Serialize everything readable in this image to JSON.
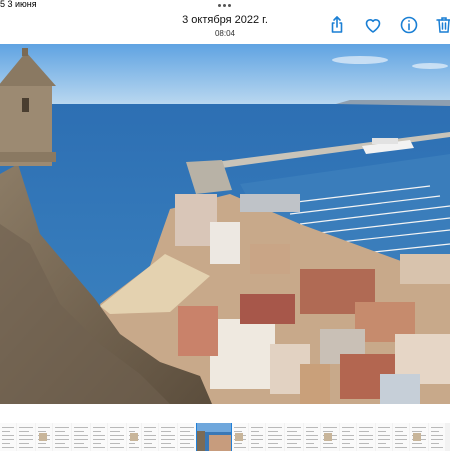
{
  "status_bar": {
    "time_text": "5 3 июня"
  },
  "header": {
    "date": "3 октября 2022 г.",
    "time": "08:04"
  },
  "toolbar": {
    "accent_color": "#1a7fd4",
    "buttons": [
      {
        "name": "share",
        "icon": "share-icon"
      },
      {
        "name": "favorite",
        "icon": "heart-icon"
      },
      {
        "name": "info",
        "icon": "info-icon"
      },
      {
        "name": "delete",
        "icon": "trash-icon"
      }
    ]
  },
  "photo": {
    "subject": "coastal city photo"
  },
  "filmstrip": {
    "thumbnail_count": 24,
    "current_index": 11
  }
}
